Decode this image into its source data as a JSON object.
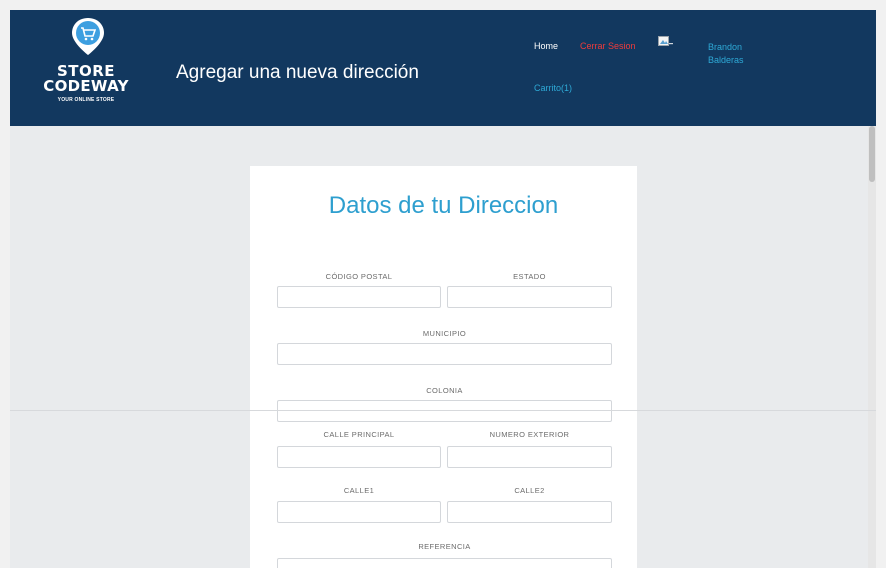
{
  "header": {
    "brand_line1": "STORE",
    "brand_line2": "CODEWAY",
    "tagline": "YOUR ONLINE STORE",
    "page_title": "Agregar una nueva dirección",
    "nav": {
      "home": "Home",
      "logout": "Cerrar Sesion",
      "user": "Brandon Balderas",
      "cart": "Carrito(1)"
    }
  },
  "form": {
    "title": "Datos de tu Direccion",
    "labels": {
      "postal_code": "CÓDIGO POSTAL",
      "state": "ESTADO",
      "municipality": "MUNICIPIO",
      "colony": "COLONIA",
      "main_street": "CALLE PRINCIPAL",
      "exterior_number": "NUMERO EXTERIOR",
      "street1": "CALLE1",
      "street2": "CALLE2",
      "reference": "REFERENCIA"
    }
  },
  "icons": {
    "logo": "cart-pin-icon",
    "user_image": "broken-image-icon"
  },
  "colors": {
    "header_bg": "#12385f",
    "accent_blue": "#2e9fcf",
    "logout_red": "#ef3b3b"
  }
}
